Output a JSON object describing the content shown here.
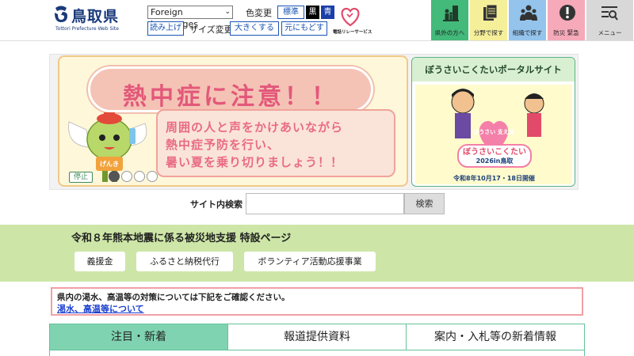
{
  "header": {
    "logo": {
      "text_jp": "鳥取県",
      "text_en": "Tottori Prefecture Web Site"
    },
    "language_select": {
      "selected": "Foreign Languages"
    },
    "color_change": {
      "label": "色変更",
      "standard": "標準",
      "black": "黒",
      "blue": "青"
    },
    "read_aloud": "読み上げ",
    "size_change": {
      "label": "サイズ変更",
      "bigger": "大きくする",
      "reset": "元にもどす"
    },
    "tel_service": {
      "text": "電話リレーサービス"
    }
  },
  "nav": [
    {
      "label": "県外の方へ",
      "color": "#43b97a",
      "icon": "family-icon"
    },
    {
      "label": "分野で探す",
      "color": "#f6ef9a",
      "icon": "documents-icon"
    },
    {
      "label": "組織で探す",
      "color": "#94c4ec",
      "icon": "people-icon"
    },
    {
      "label": "防災 緊急",
      "color": "#f5a9b9",
      "icon": "alert-icon"
    },
    {
      "label": "メニュー",
      "color": "#d8d8d8",
      "icon": "menu-icon"
    }
  ],
  "hero": {
    "banner_title": "熱中症に注意！！",
    "banner_lines": [
      "周囲の人と声をかけあいながら",
      "熱中症予防を行い、",
      "暑い夏を乗り切りましょう！！"
    ],
    "mascot_badge": "げんき",
    "stop_label": "停止",
    "slide_count": 4,
    "active_slide": 1
  },
  "side_banner": {
    "title": "ぼうさいこくたいポータルサイト",
    "art_badge": "ぼうさい 支え愛",
    "art_event": "ぼうさいこくたい",
    "art_place": "2026in鳥取",
    "date": "令和8年10月17・18日開催"
  },
  "search": {
    "label": "サイト内検索",
    "placeholder": "",
    "button": "検索"
  },
  "support": {
    "title": "令和８年熊本地震に係る被災地支援 特設ページ",
    "buttons": [
      "義援金",
      "ふるさと納税代行",
      "ボランティア活動応援事業"
    ]
  },
  "notice": {
    "text": "県内の渇水、高温等の対策については下記をご確認ください。",
    "link": "渇水、高温等について"
  },
  "tabs": [
    {
      "label": "注目・新着",
      "active": true
    },
    {
      "label": "報道提供資料",
      "active": false
    },
    {
      "label": "案内・入札等の新着情報",
      "active": false
    }
  ]
}
